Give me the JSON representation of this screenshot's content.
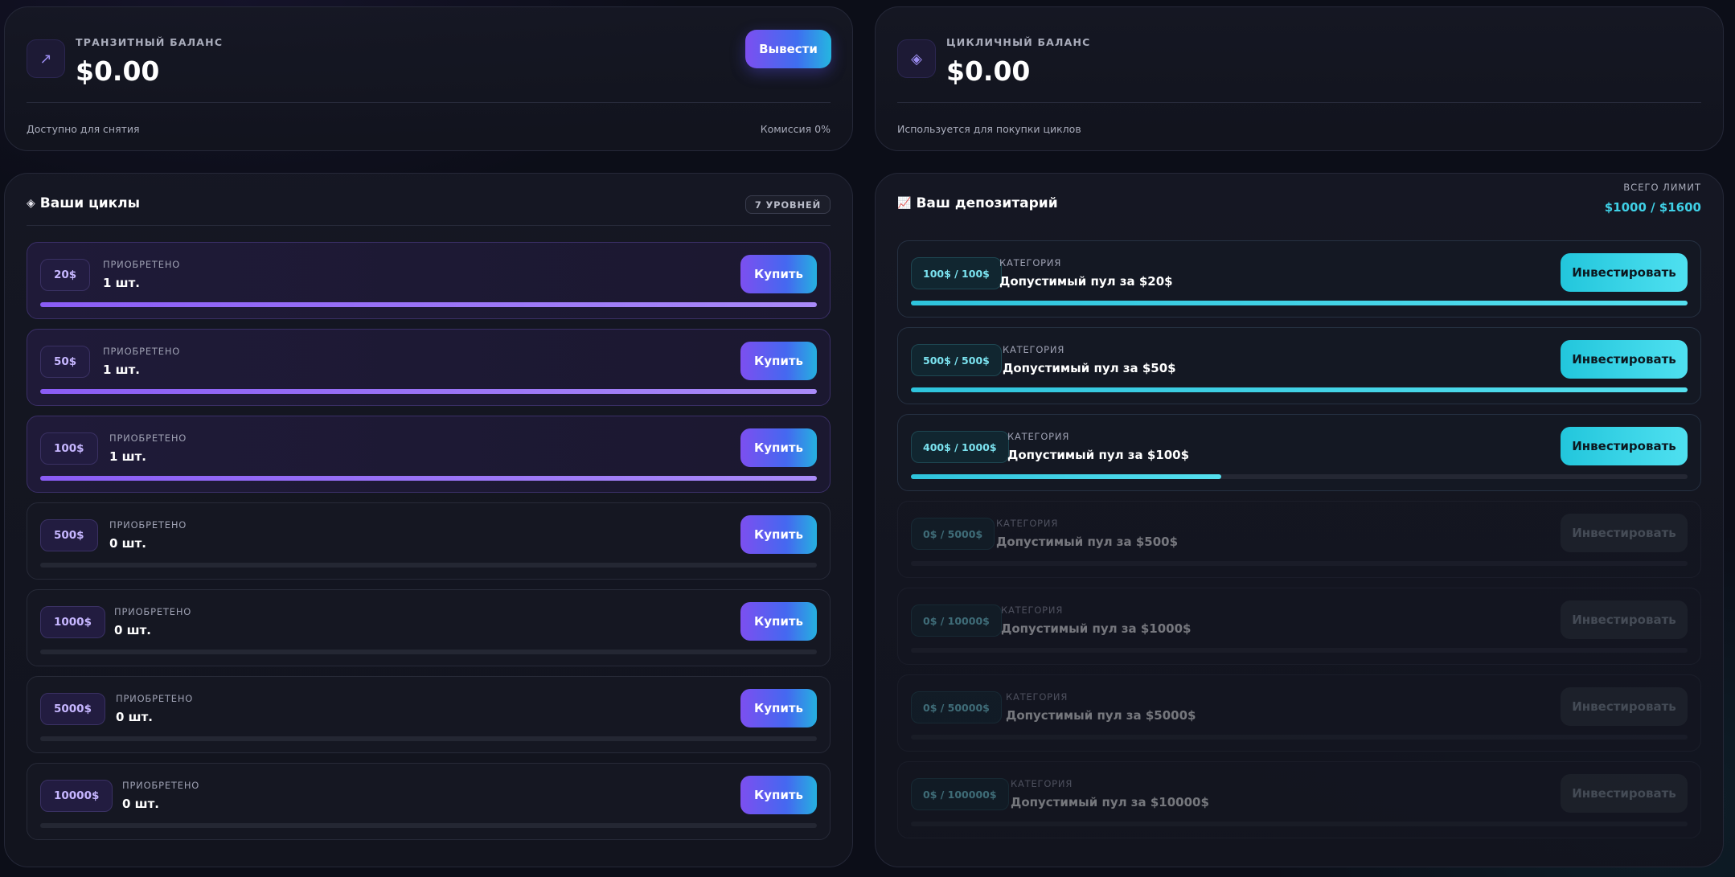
{
  "transit": {
    "label": "ТРАНЗИТНЫЙ БАЛАНС",
    "amount": "$0.00",
    "icon": "arrow-up-right-icon",
    "withdraw_label": "Вывести",
    "foot_left": "Доступно для снятия",
    "foot_right": "Комиссия 0%"
  },
  "cyclic": {
    "label": "ЦИКЛИЧНЫЙ БАЛАНС",
    "amount": "$0.00",
    "icon": "diamond-icon",
    "foot_left": "Используется для покупки циклов"
  },
  "cycles": {
    "title": "Ваши циклы",
    "title_icon": "◈",
    "levels_badge": "7 УРОВНЕЙ",
    "items": [
      {
        "tag": "20$",
        "label": "ПРИОБРЕТЕНО",
        "value": "1 шт.",
        "button": "Купить",
        "progress": 1
      },
      {
        "tag": "50$",
        "label": "ПРИОБРЕТЕНО",
        "value": "1 шт.",
        "button": "Купить",
        "progress": 1
      },
      {
        "tag": "100$",
        "label": "ПРИОБРЕТЕНО",
        "value": "1 шт.",
        "button": "Купить",
        "progress": 1
      },
      {
        "tag": "500$",
        "label": "ПРИОБРЕТЕНО",
        "value": "0 шт.",
        "button": "Купить",
        "progress": 0
      },
      {
        "tag": "1000$",
        "label": "ПРИОБРЕТЕНО",
        "value": "0 шт.",
        "button": "Купить",
        "progress": 0
      },
      {
        "tag": "5000$",
        "label": "ПРИОБРЕТЕНО",
        "value": "0 шт.",
        "button": "Купить",
        "progress": 0
      },
      {
        "tag": "10000$",
        "label": "ПРИОБРЕТЕНО",
        "value": "0 шт.",
        "button": "Купить",
        "progress": 0
      }
    ]
  },
  "depository": {
    "title": "Ваш депозитарий",
    "title_icon": "📈",
    "limit_label": "ВСЕГО ЛИМИТ",
    "limit_value": "$1000 / $1600",
    "items": [
      {
        "tag": "100$ / 100$",
        "label": "КАТЕГОРИЯ",
        "value": "Допустимый пул за $20$",
        "button": "Инвестировать",
        "progress": 1.0,
        "enabled": true
      },
      {
        "tag": "500$ / 500$",
        "label": "КАТЕГОРИЯ",
        "value": "Допустимый пул за $50$",
        "button": "Инвестировать",
        "progress": 1.0,
        "enabled": true
      },
      {
        "tag": "400$ / 1000$",
        "label": "КАТЕГОРИЯ",
        "value": "Допустимый пул за $100$",
        "button": "Инвестировать",
        "progress": 0.4,
        "enabled": true
      },
      {
        "tag": "0$ / 5000$",
        "label": "КАТЕГОРИЯ",
        "value": "Допустимый пул за $500$",
        "button": "Инвестировать",
        "progress": 0,
        "enabled": false
      },
      {
        "tag": "0$ / 10000$",
        "label": "КАТЕГОРИЯ",
        "value": "Допустимый пул за $1000$",
        "button": "Инвестировать",
        "progress": 0,
        "enabled": false
      },
      {
        "tag": "0$ / 50000$",
        "label": "КАТЕГОРИЯ",
        "value": "Допустимый пул за $5000$",
        "button": "Инвестировать",
        "progress": 0,
        "enabled": false
      },
      {
        "tag": "0$ / 100000$",
        "label": "КАТЕГОРИЯ",
        "value": "Допустимый пул за $10000$",
        "button": "Инвестировать",
        "progress": 0,
        "enabled": false
      }
    ]
  }
}
